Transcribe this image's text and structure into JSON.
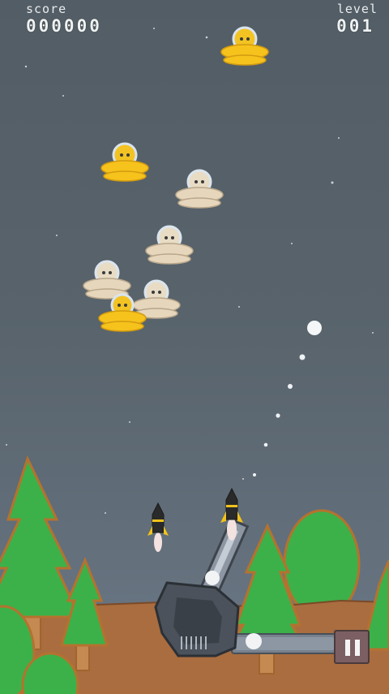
{
  "hud": {
    "score_label": "score",
    "score_value": "000000",
    "level_label": "level",
    "level_value": "001"
  },
  "colors": {
    "sky": "#56616a",
    "tree_green": "#3cb149",
    "tree_outline": "#b5722f",
    "ground": "#a86c3e",
    "ufo_yellow": "#f6c21c",
    "ufo_beige": "#e6d6bc",
    "pause_button": "#7b5f62"
  },
  "enemies": [
    {
      "type": "ufo-yellow"
    },
    {
      "type": "ufo-yellow"
    },
    {
      "type": "ufo-beige"
    },
    {
      "type": "ufo-beige"
    },
    {
      "type": "ufo-beige"
    },
    {
      "type": "ufo-beige"
    },
    {
      "type": "ufo-yellow"
    }
  ],
  "controls": {
    "pause_icon": "pause-icon",
    "power_meter_icon": "power-meter"
  }
}
